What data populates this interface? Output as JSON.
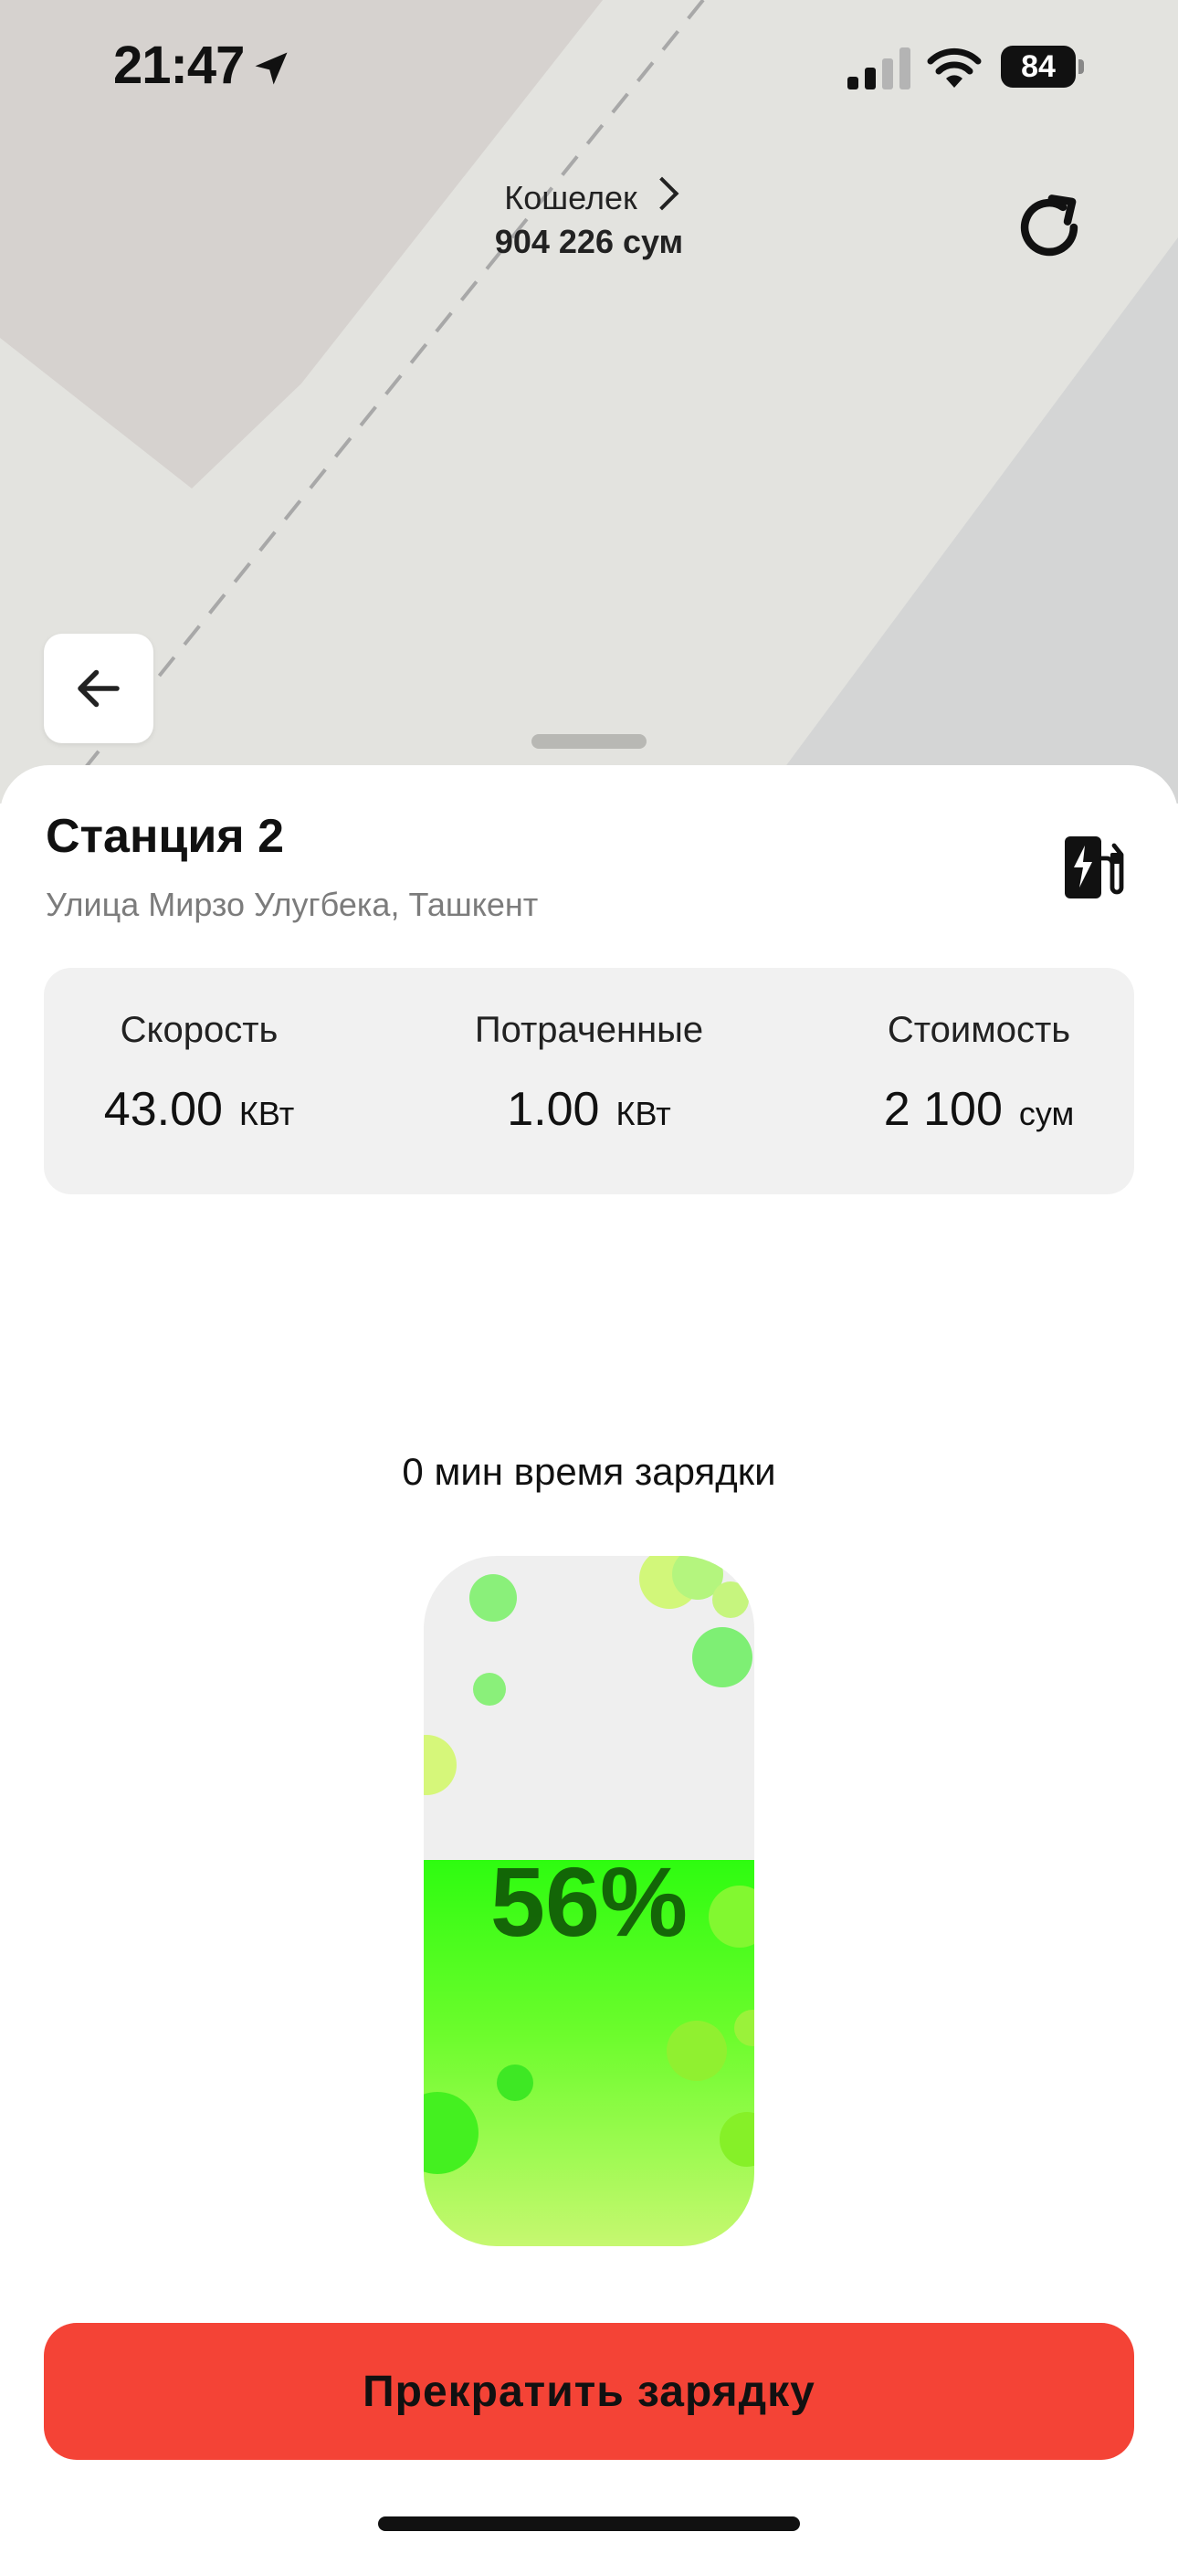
{
  "status_bar": {
    "time": "21:47",
    "battery": "84"
  },
  "wallet": {
    "label": "Кошелек",
    "amount": "904 226 сум"
  },
  "station": {
    "title": "Станция 2",
    "address": "Улица Мирзо Улугбека, Ташкент"
  },
  "stats": [
    {
      "label": "Скорость",
      "value": "43.00",
      "unit": "КВт"
    },
    {
      "label": "Потраченные",
      "value": "1.00",
      "unit": "КВт"
    },
    {
      "label": "Стоимость",
      "value": "2 100",
      "unit": "сум"
    }
  ],
  "charging": {
    "time_text": "0 мин время зарядки",
    "percent": 56,
    "percent_label": "56%"
  },
  "actions": {
    "stop_label": "Прекратить зарядку"
  },
  "colors": {
    "accent": "#f44336",
    "fill_top": "#2efc10",
    "fill_bottom": "#c6f870",
    "stats_bg": "#f1f1f1"
  },
  "icons": [
    "location-arrow-icon",
    "signal-icon",
    "wifi-icon",
    "battery-icon",
    "chevron-right-icon",
    "refresh-icon",
    "arrow-left-icon",
    "ev-charger-icon"
  ]
}
